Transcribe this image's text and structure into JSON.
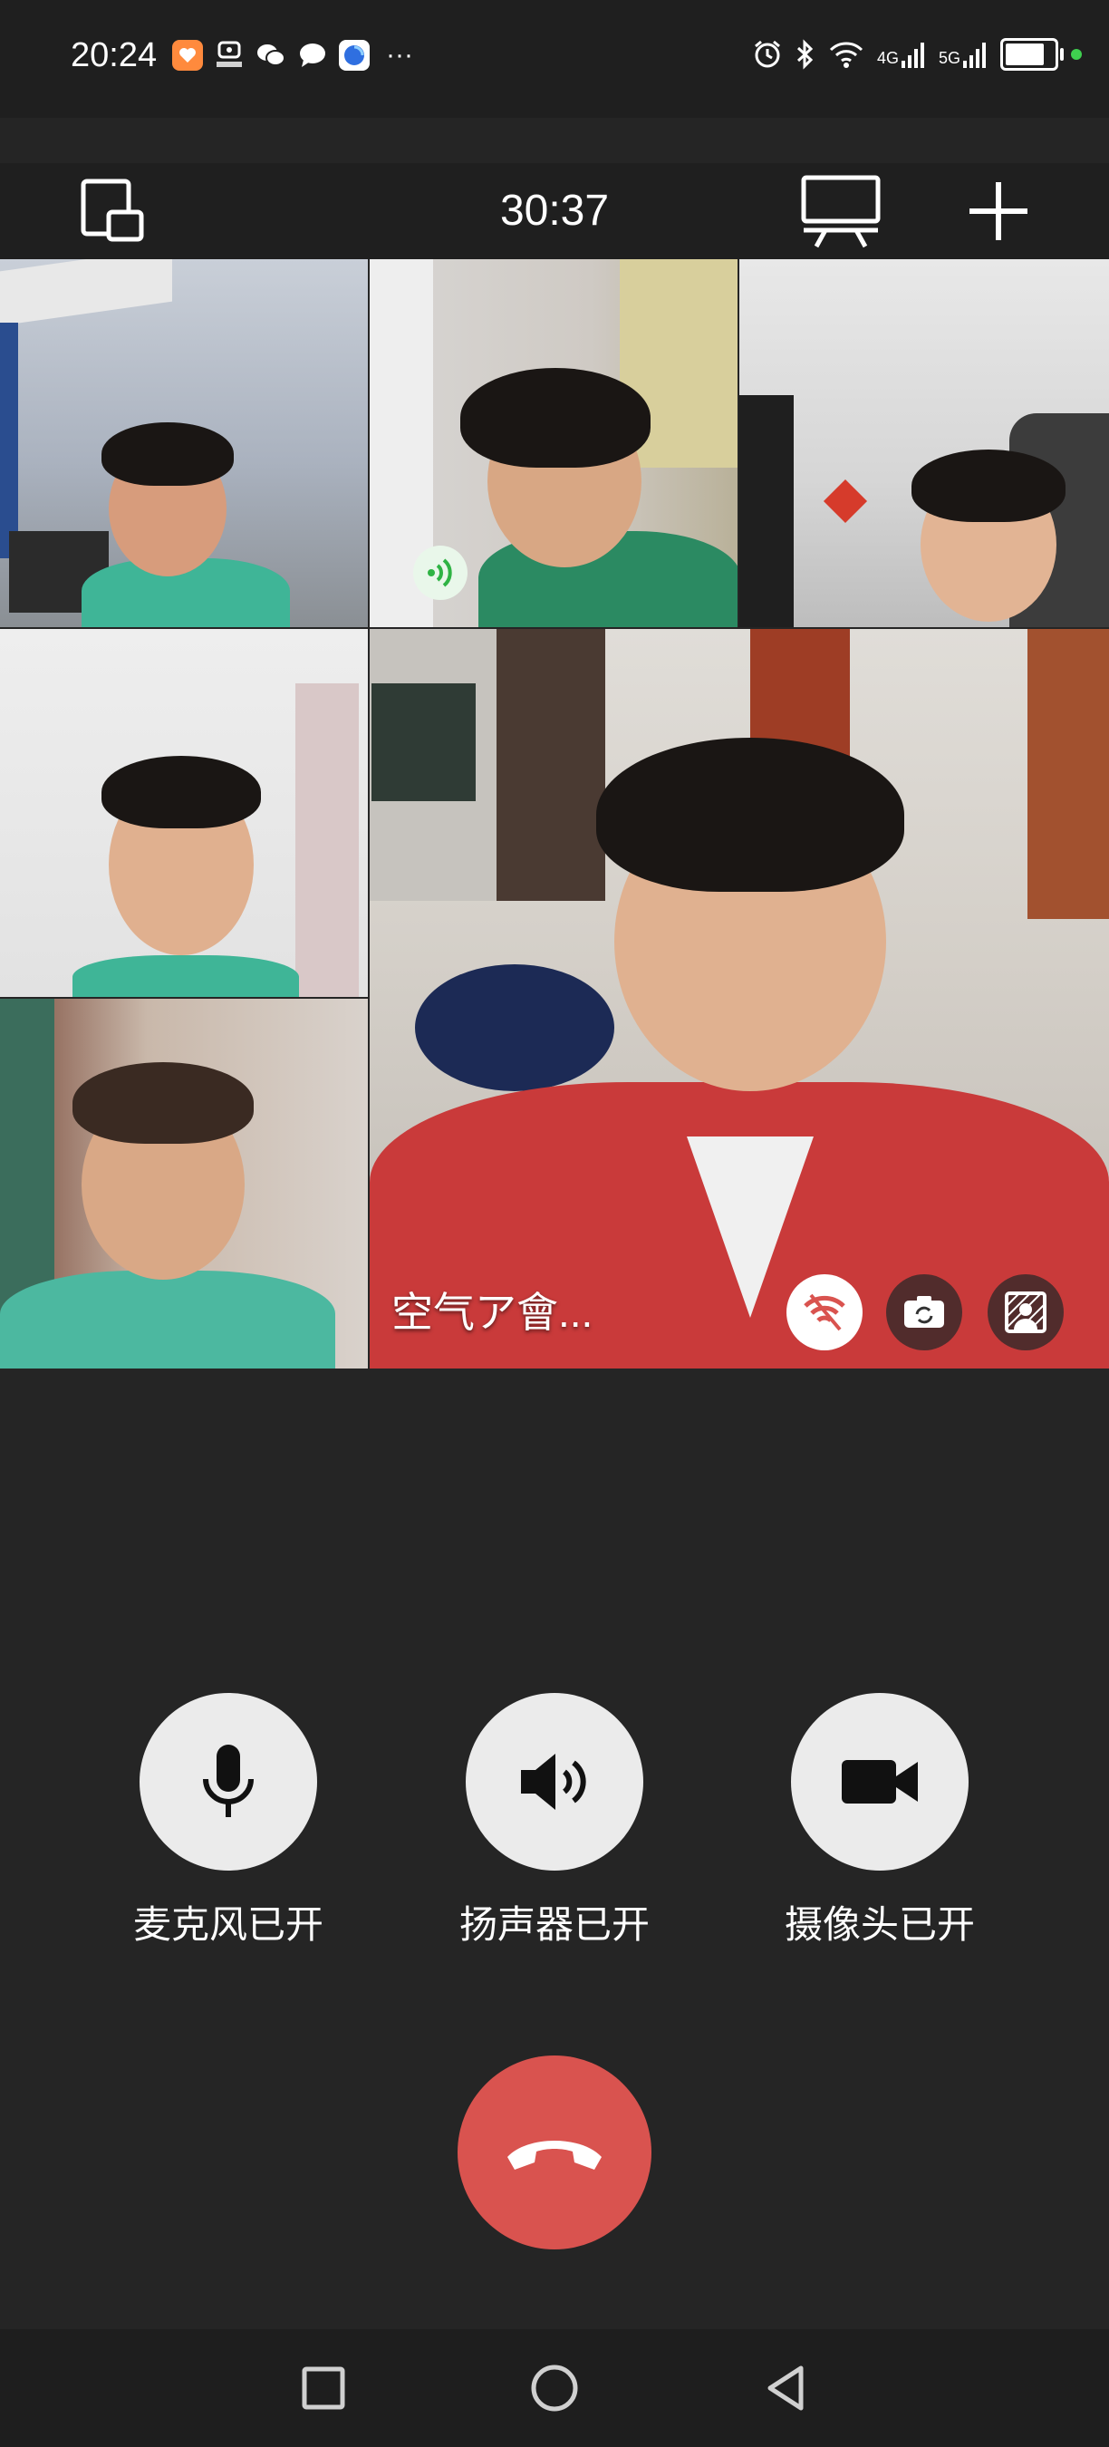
{
  "status_bar": {
    "time": "20:24",
    "left_icons": [
      "taobao-app-icon",
      "taobao-live-icon",
      "wechat-icon",
      "message-icon",
      "browser-icon"
    ],
    "more": "···",
    "right_icons": [
      "alarm-icon",
      "bluetooth-icon",
      "wifi-icon",
      "signal-4g-icon",
      "signal-5g-icon",
      "battery-icon"
    ],
    "network_1": "4G",
    "network_2": "5G",
    "battery_level": 0.8,
    "colors": {
      "dot": "#3fcf4f"
    }
  },
  "toolbar": {
    "call_duration": "30:37",
    "buttons": [
      "minimize-window-icon",
      "screen-share-icon",
      "add-participant-icon"
    ]
  },
  "participants": [
    {
      "tile": 1,
      "speaking": false
    },
    {
      "tile": 2,
      "speaking": true
    },
    {
      "tile": 3,
      "speaking": false
    },
    {
      "tile": 4,
      "speaking": false
    },
    {
      "tile": 5,
      "speaking": false
    },
    {
      "tile": 6,
      "is_self": true,
      "name": "空气ア會...",
      "controls": [
        "weak-network-icon",
        "flip-camera-icon",
        "background-blur-icon"
      ]
    }
  ],
  "controls": {
    "mic_label": "麦克风已开",
    "speaker_label": "扬声器已开",
    "camera_label": "摄像头已开",
    "hangup": "hang-up-icon",
    "colors": {
      "hangup": "#d9534f",
      "button_bg": "#ebebeb"
    }
  },
  "nav_bar": {
    "buttons": [
      "recent-apps-icon",
      "home-icon",
      "back-icon"
    ]
  }
}
